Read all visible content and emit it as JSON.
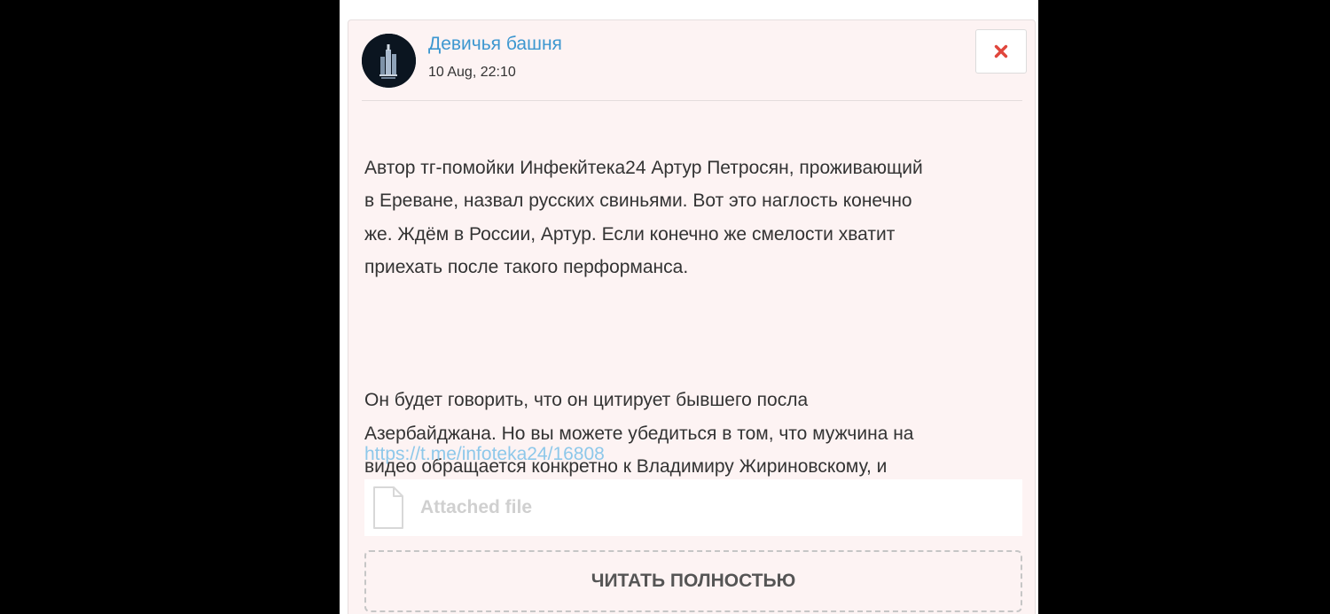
{
  "post": {
    "channel_name": "Девичья башня",
    "date": "10 Aug, 22:10",
    "paragraph_1": "Автор тг-помойки Инфекйтека24 Артур Петросян, проживающий\nв Ереване, назвал русских свиньями. Вот это наглость конечно\nже. Ждём в России, Артур. Если конечно же смелости хватит\nприехать после такого перформанса.",
    "paragraph_2": "Он будет говорить, что он цитирует бывшего посла\nАзербайджана. Но вы можете убедиться в том, что мужчина на\nвидео обращается конкретно к Владимиру Жириновскому, и\nнигде нет фразы «русские - свиньи».",
    "link": "https://t.me/infoteka24/16808",
    "attachment_label": "Attached file",
    "read_more_label": "ЧИТАТЬ ПОЛНОСТЬЮ"
  },
  "icons": {
    "close": "close-icon",
    "avatar": "channel-avatar",
    "file": "file-icon"
  },
  "colors": {
    "background": "#000000",
    "card_background": "#fdf3f3",
    "channel_name": "#3d97d0",
    "close_icon": "#e0463c",
    "link": "#8ec8ea",
    "attachment_text": "#d0d0d0"
  }
}
